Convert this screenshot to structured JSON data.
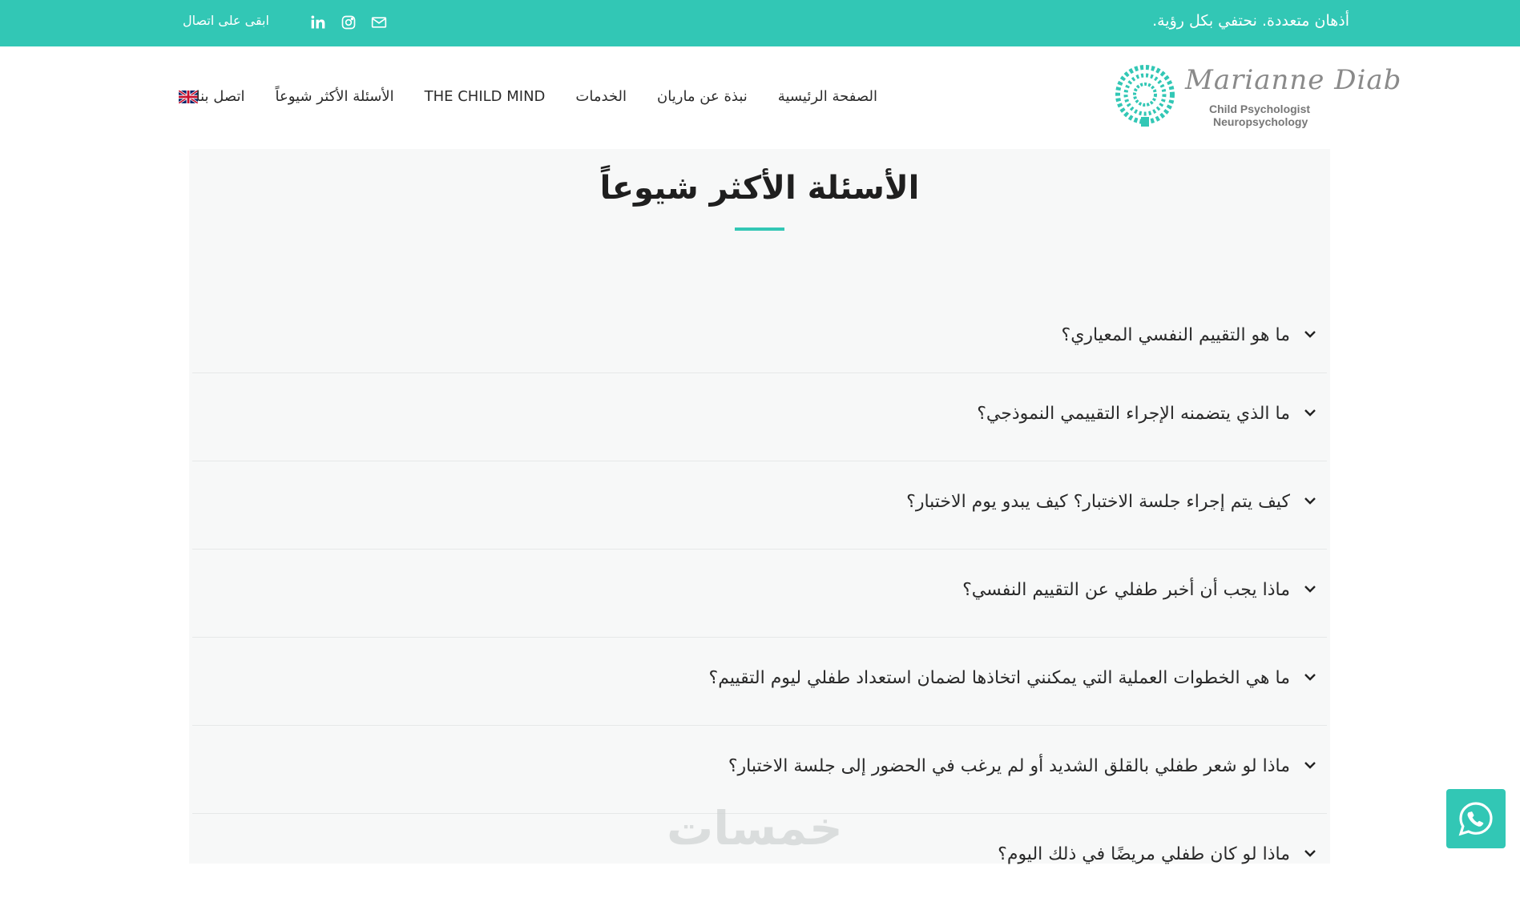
{
  "topbar": {
    "tagline": "أذهان متعددة. نحتفي بكل رؤية.",
    "stay_connected": "ابقى على اتصال",
    "social_icons": [
      "email-icon",
      "instagram-icon",
      "linkedin-icon"
    ]
  },
  "header": {
    "logo": {
      "script": "Marianne Diab",
      "line1": "Child Psychologist",
      "line2": "Neuropsychology"
    },
    "nav": [
      "الصفحة الرئيسية",
      "نبذة عن ماريان",
      "الخدمات",
      "THE CHILD MIND",
      "الأسئلة الأكثر شيوعاً",
      "اتصل بنا"
    ],
    "language_icon": "uk-flag-icon"
  },
  "main": {
    "title": "الأسئلة الأكثر شيوعاً",
    "faq": [
      "ما هو التقييم النفسي المعياري؟",
      "ما الذي يتضمنه الإجراء التقييمي النموذجي؟",
      "كيف يتم إجراء جلسة الاختبار؟ كيف يبدو يوم الاختبار؟",
      "ماذا يجب أن أخبر طفلي عن التقييم النفسي؟",
      "ما هي الخطوات العملية التي يمكنني اتخاذها لضمان استعداد طفلي ليوم التقييم؟",
      "ماذا لو شعر طفلي بالقلق الشديد أو لم يرغب في الحضور إلى جلسة الاختبار؟",
      "ماذا لو كان طفلي مريضًا في ذلك اليوم؟"
    ]
  },
  "watermark": "خمسات",
  "colors": {
    "accent": "#32c7b5",
    "card_bg": "#f7f8f8",
    "text": "#2a2a2a"
  },
  "floating": {
    "whatsapp_icon": "whatsapp-icon"
  }
}
